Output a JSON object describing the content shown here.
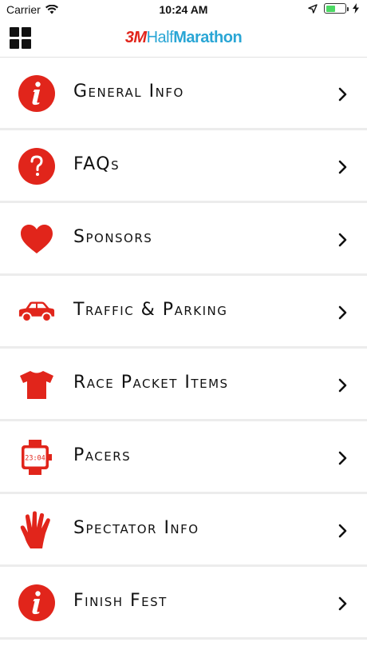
{
  "status_bar": {
    "carrier": "Carrier",
    "time": "10:24 AM",
    "battery_level": 0.5
  },
  "header": {
    "logo_3m": "3M",
    "logo_half": "Half",
    "logo_marathon": "Marathon",
    "menu_icon": "grid-icon"
  },
  "colors": {
    "brand_red": "#e1251b",
    "brand_blue": "#2aa6d5",
    "battery_green": "#4cd964"
  },
  "menu_items": [
    {
      "label": "General Info",
      "icon": "info-icon"
    },
    {
      "label": "FAQs",
      "icon": "question-icon"
    },
    {
      "label": "Sponsors",
      "icon": "heart-icon"
    },
    {
      "label": "Traffic & Parking",
      "icon": "car-icon"
    },
    {
      "label": "Race Packet Items",
      "icon": "tshirt-icon"
    },
    {
      "label": "Pacers",
      "icon": "watch-icon"
    },
    {
      "label": "Spectator Info",
      "icon": "hand-icon"
    },
    {
      "label": "Finish Fest",
      "icon": "info-icon"
    }
  ]
}
